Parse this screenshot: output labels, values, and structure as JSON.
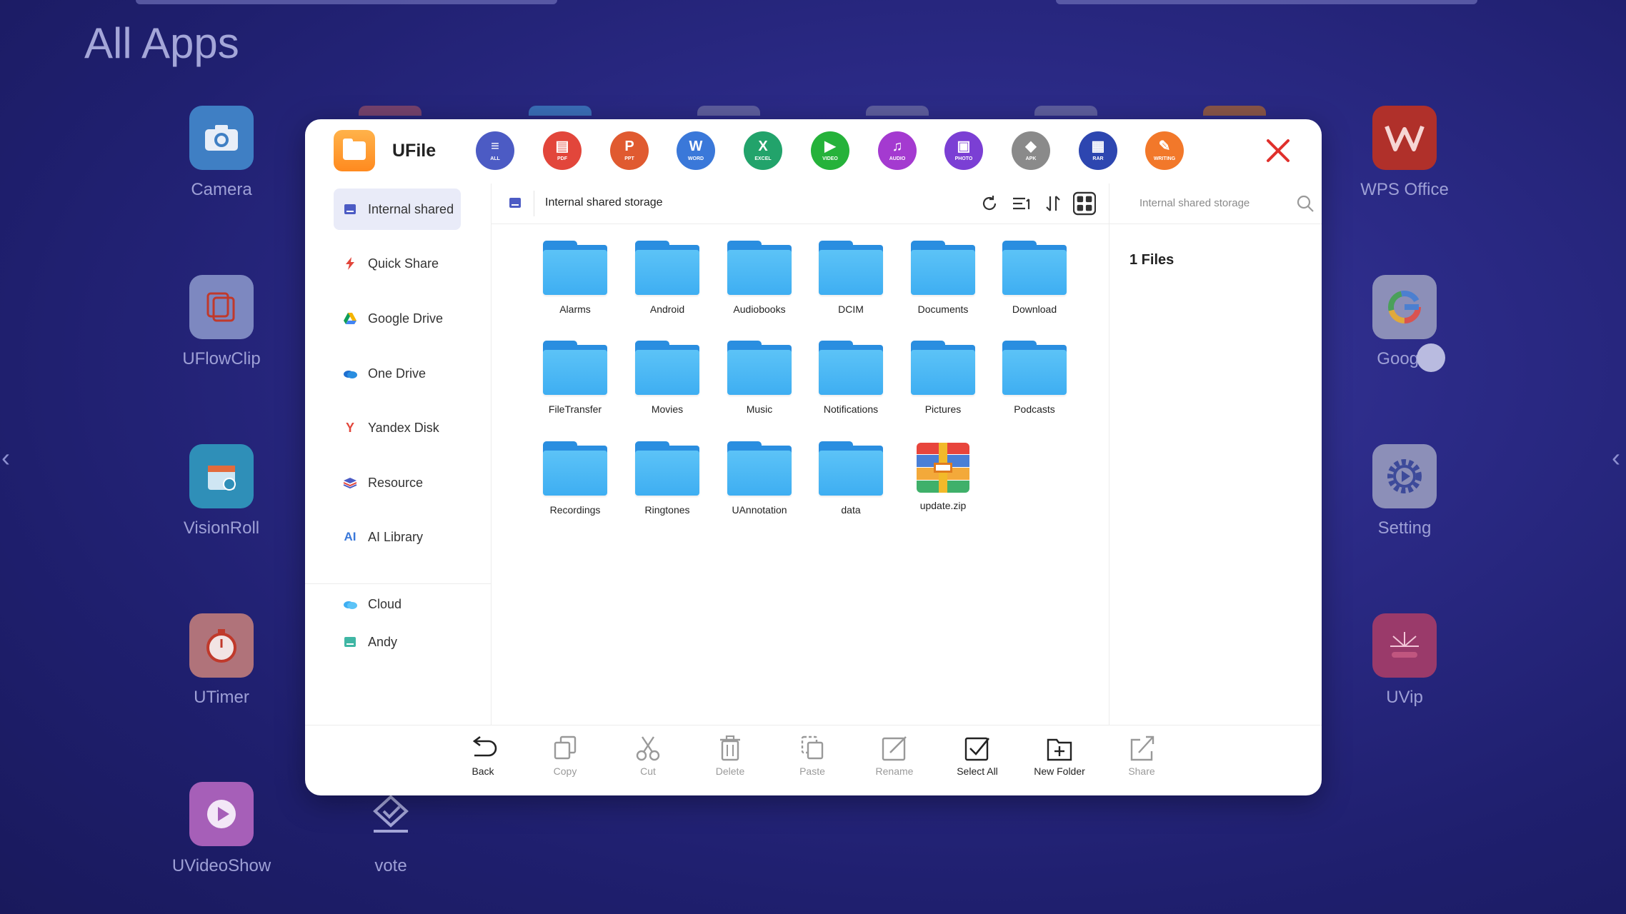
{
  "launcher": {
    "title": "All Apps",
    "apps_left": [
      {
        "label": "Camera",
        "icon": "camera-icon"
      },
      {
        "label": "UFlowClip",
        "icon": "uflowclip-icon"
      },
      {
        "label": "VisionRoll",
        "icon": "visionroll-icon"
      },
      {
        "label": "UTimer",
        "icon": "timer-icon"
      },
      {
        "label": "UVideoShow",
        "icon": "video-show-icon"
      }
    ],
    "apps_right": [
      {
        "label": "WPS Office",
        "icon": "wps-icon"
      },
      {
        "label": "Google",
        "icon": "google-icon"
      },
      {
        "label": "Setting",
        "icon": "gear-icon"
      },
      {
        "label": "UVip",
        "icon": "uvip-icon"
      }
    ],
    "app_vote": {
      "label": "vote",
      "icon": "vote-icon"
    }
  },
  "window": {
    "app_name": "UFile",
    "categories": [
      {
        "tag": "ALL",
        "glyph": "≡",
        "color": "#4c5bc4"
      },
      {
        "tag": "PDF",
        "glyph": "▤",
        "color": "#e2463b"
      },
      {
        "tag": "PPT",
        "glyph": "P",
        "color": "#e05a30"
      },
      {
        "tag": "WORD",
        "glyph": "W",
        "color": "#3a78d9"
      },
      {
        "tag": "EXCEL",
        "glyph": "X",
        "color": "#22a36b"
      },
      {
        "tag": "VIDEO",
        "glyph": "▶",
        "color": "#25b23a"
      },
      {
        "tag": "AUDIO",
        "glyph": "♫",
        "color": "#a43ad0"
      },
      {
        "tag": "PHOTO",
        "glyph": "▣",
        "color": "#7b3fd4"
      },
      {
        "tag": "APK",
        "glyph": "◆",
        "color": "#8a8a8a"
      },
      {
        "tag": "RAR",
        "glyph": "▦",
        "color": "#2d46b0"
      },
      {
        "tag": "WRITING",
        "glyph": "✎",
        "color": "#f2782a"
      }
    ],
    "sidebar": [
      {
        "label": "Internal shared",
        "icon": "storage-icon",
        "active": true
      },
      {
        "label": "Quick Share",
        "icon": "quick-share-icon",
        "active": false
      },
      {
        "label": "Google Drive",
        "icon": "google-drive-icon",
        "active": false
      },
      {
        "label": "One Drive",
        "icon": "onedrive-icon",
        "active": false
      },
      {
        "label": "Yandex Disk",
        "icon": "yandex-icon",
        "active": false
      },
      {
        "label": "Resource",
        "icon": "resource-icon",
        "active": false
      },
      {
        "label": "AI Library",
        "icon": "ai-library-icon",
        "active": false
      }
    ],
    "sidebar_lower": [
      {
        "label": "Cloud",
        "icon": "cloud-icon"
      },
      {
        "label": "Andy",
        "icon": "user-storage-icon"
      }
    ],
    "path": "Internal shared storage",
    "search_placeholder": "Internal shared storage",
    "files_count": "1 Files",
    "files": [
      {
        "name": "Alarms",
        "type": "folder"
      },
      {
        "name": "Android",
        "type": "folder"
      },
      {
        "name": "Audiobooks",
        "type": "folder"
      },
      {
        "name": "DCIM",
        "type": "folder"
      },
      {
        "name": "Documents",
        "type": "folder"
      },
      {
        "name": "Download",
        "type": "folder"
      },
      {
        "name": "FileTransfer",
        "type": "folder"
      },
      {
        "name": "Movies",
        "type": "folder"
      },
      {
        "name": "Music",
        "type": "folder"
      },
      {
        "name": "Notifications",
        "type": "folder"
      },
      {
        "name": "Pictures",
        "type": "folder"
      },
      {
        "name": "Podcasts",
        "type": "folder"
      },
      {
        "name": "Recordings",
        "type": "folder"
      },
      {
        "name": "Ringtones",
        "type": "folder"
      },
      {
        "name": "UAnnotation",
        "type": "folder"
      },
      {
        "name": "data",
        "type": "folder"
      },
      {
        "name": "update.zip",
        "type": "zip"
      }
    ],
    "bottom_actions": [
      {
        "label": "Back",
        "enabled": true,
        "icon": "back-icon"
      },
      {
        "label": "Copy",
        "enabled": false,
        "icon": "copy-icon"
      },
      {
        "label": "Cut",
        "enabled": false,
        "icon": "cut-icon"
      },
      {
        "label": "Delete",
        "enabled": false,
        "icon": "delete-icon"
      },
      {
        "label": "Paste",
        "enabled": false,
        "icon": "paste-icon"
      },
      {
        "label": "Rename",
        "enabled": false,
        "icon": "rename-icon"
      },
      {
        "label": "Select All",
        "enabled": true,
        "icon": "select-all-icon"
      },
      {
        "label": "New Folder",
        "enabled": true,
        "icon": "new-folder-icon"
      },
      {
        "label": "Share",
        "enabled": false,
        "icon": "share-icon"
      }
    ]
  }
}
